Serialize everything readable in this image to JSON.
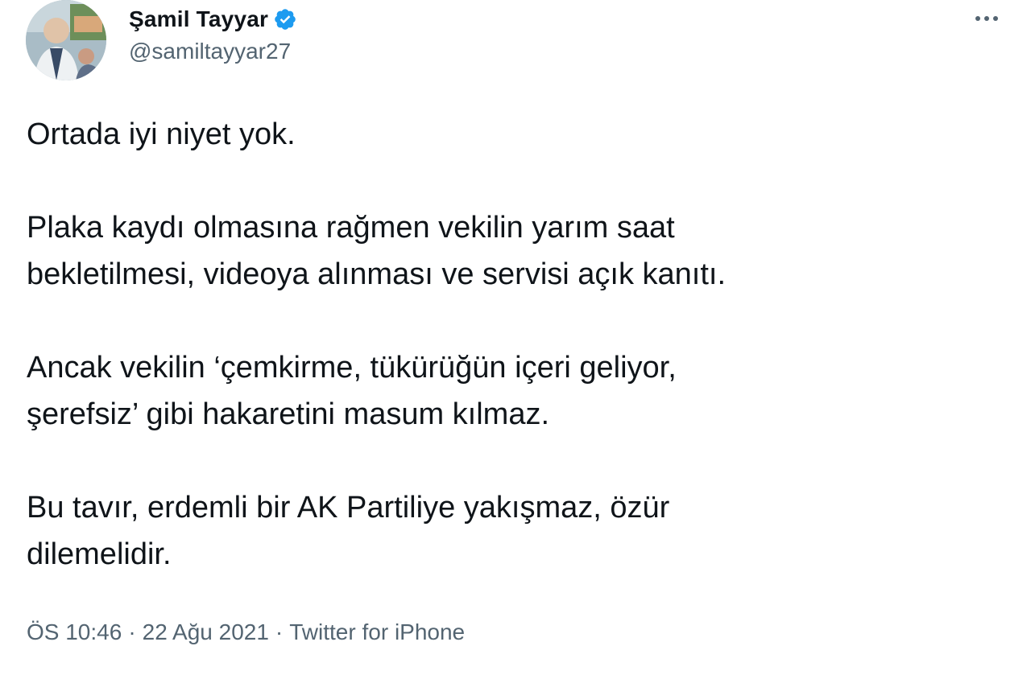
{
  "author": {
    "display_name": "Şamil Tayyar",
    "handle": "@samiltayyar27",
    "verified": true
  },
  "colors": {
    "verified_badge": "#1d9bf0",
    "secondary_text": "#536471",
    "primary_text": "#0f1419"
  },
  "icons": {
    "avatar": "profile-photo",
    "verified": "verified-badge-icon",
    "more": "more-options-icon"
  },
  "tweet": {
    "paragraphs": [
      "Ortada iyi niyet yok.",
      "Plaka kaydı olmasına rağmen vekilin yarım saat\nbekletilmesi, videoya alınması ve servisi açık kanıtı.",
      "Ancak vekilin ‘çemkirme, tükürüğün içeri geliyor,\nşerefsiz’ gibi hakaretini masum kılmaz.",
      "Bu tavır, erdemli bir AK Partiliye yakışmaz, özür\ndilemelidir."
    ]
  },
  "meta": {
    "time": "ÖS 10:46",
    "date": "22 Ağu 2021",
    "source": "Twitter for iPhone",
    "separator": "·"
  }
}
